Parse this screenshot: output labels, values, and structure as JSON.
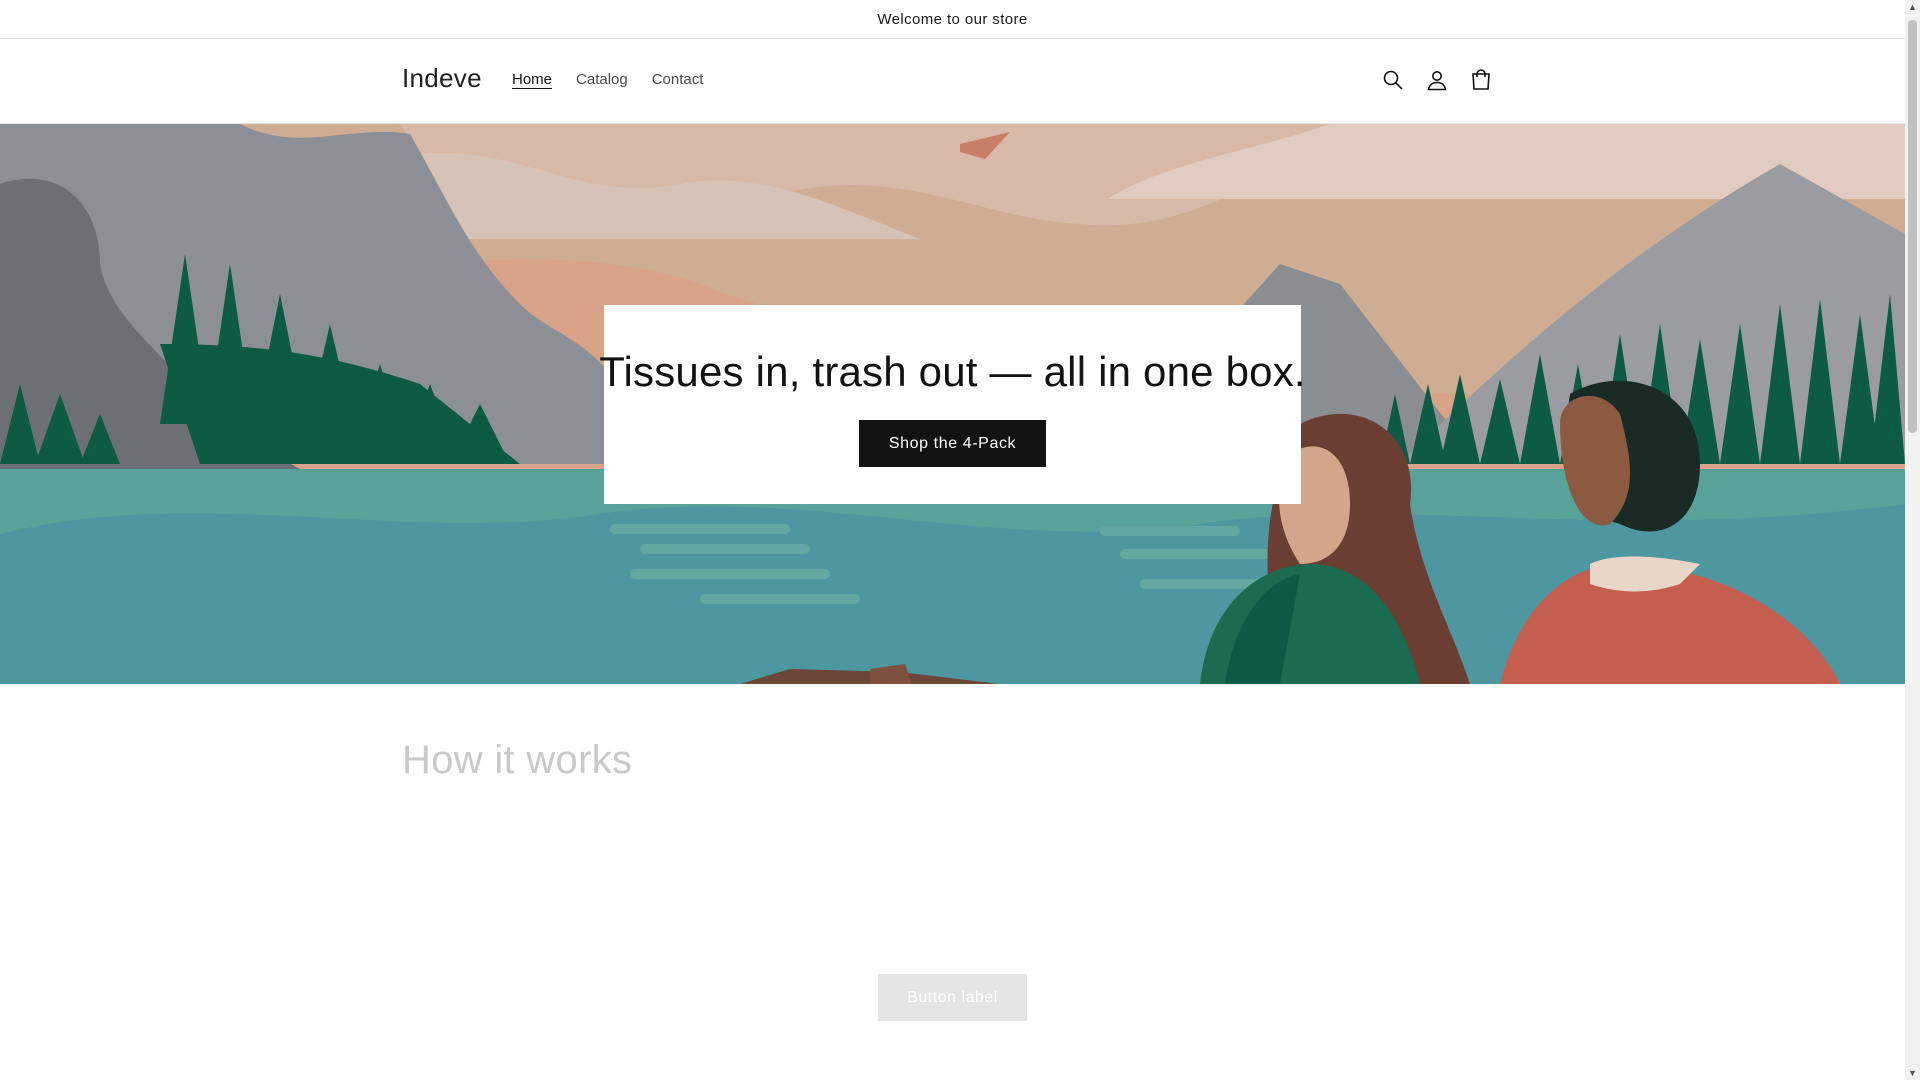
{
  "announcement": {
    "text": "Welcome to our store"
  },
  "header": {
    "logo": "Indeve",
    "nav": [
      {
        "label": "Home",
        "active": true
      },
      {
        "label": "Catalog",
        "active": false
      },
      {
        "label": "Contact",
        "active": false
      }
    ],
    "icons": [
      "search-icon",
      "account-icon",
      "cart-icon"
    ]
  },
  "hero": {
    "title": "Tissues in, trash out — all in one box.",
    "button_label": "Shop the 4-Pack"
  },
  "how_it_works": {
    "title": "How it works",
    "button_label": "Button label"
  },
  "colors": {
    "text": "#121212",
    "button_dark": "#121212",
    "ghost_button": "#e5e5e5",
    "muted_heading": "#c9c9c9"
  }
}
